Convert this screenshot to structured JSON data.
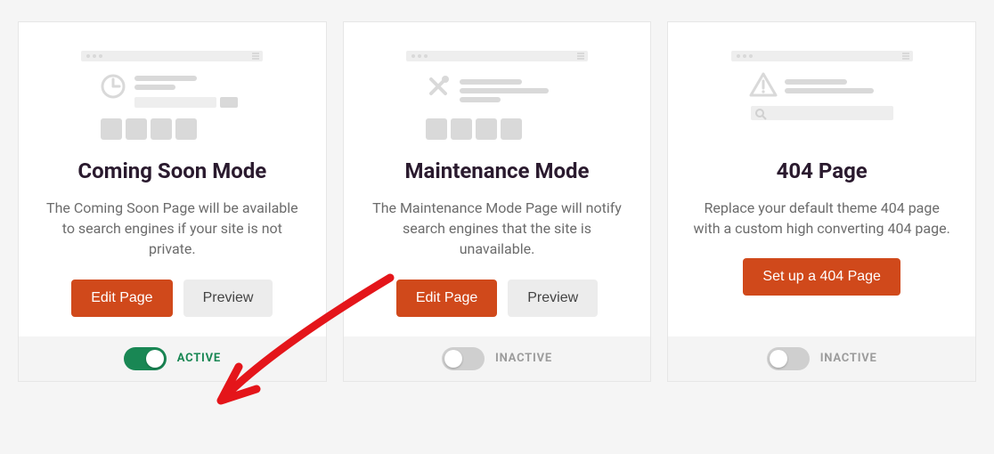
{
  "cards": [
    {
      "title": "Coming Soon Mode",
      "desc": "The Coming Soon Page will be available to search engines if your site is not private.",
      "edit_label": "Edit Page",
      "preview_label": "Preview",
      "status_label": "ACTIVE",
      "active": true
    },
    {
      "title": "Maintenance Mode",
      "desc": "The Maintenance Mode Page will notify search engines that the site is unavailable.",
      "edit_label": "Edit Page",
      "preview_label": "Preview",
      "status_label": "INACTIVE",
      "active": false
    },
    {
      "title": "404 Page",
      "desc": "Replace your default theme 404 page with a custom high converting 404 page.",
      "setup_label": "Set up a 404 Page",
      "status_label": "INACTIVE",
      "active": false
    }
  ]
}
